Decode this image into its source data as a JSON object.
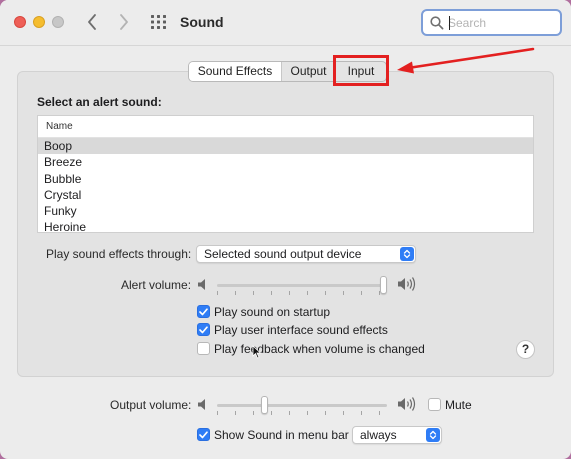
{
  "window": {
    "title": "Sound",
    "search": {
      "placeholder": "Search",
      "value": ""
    }
  },
  "tabs": [
    {
      "label": "Sound Effects",
      "active": true
    },
    {
      "label": "Output",
      "active": false
    },
    {
      "label": "Input",
      "active": false
    }
  ],
  "alert_section": {
    "label": "Select an alert sound:",
    "column_header": "Name",
    "sounds": [
      "Boop",
      "Breeze",
      "Bubble",
      "Crystal",
      "Funky",
      "Heroine"
    ],
    "selected": "Boop"
  },
  "play_through": {
    "label": "Play sound effects through:",
    "value": "Selected sound output device"
  },
  "alert_volume": {
    "label": "Alert volume:",
    "level": 1.0
  },
  "options": [
    {
      "label": "Play sound on startup",
      "checked": true
    },
    {
      "label": "Play user interface sound effects",
      "checked": true
    },
    {
      "label": "Play feedback when volume is changed",
      "checked": false
    }
  ],
  "help_label": "?",
  "output_volume": {
    "label": "Output volume:",
    "level": 0.27,
    "mute_label": "Mute",
    "muted": false
  },
  "menu_bar": {
    "label": "Show Sound in menu bar",
    "checked": true,
    "value": "always"
  },
  "colors": {
    "accent": "#2f7df6",
    "annotation": "#e32020"
  }
}
